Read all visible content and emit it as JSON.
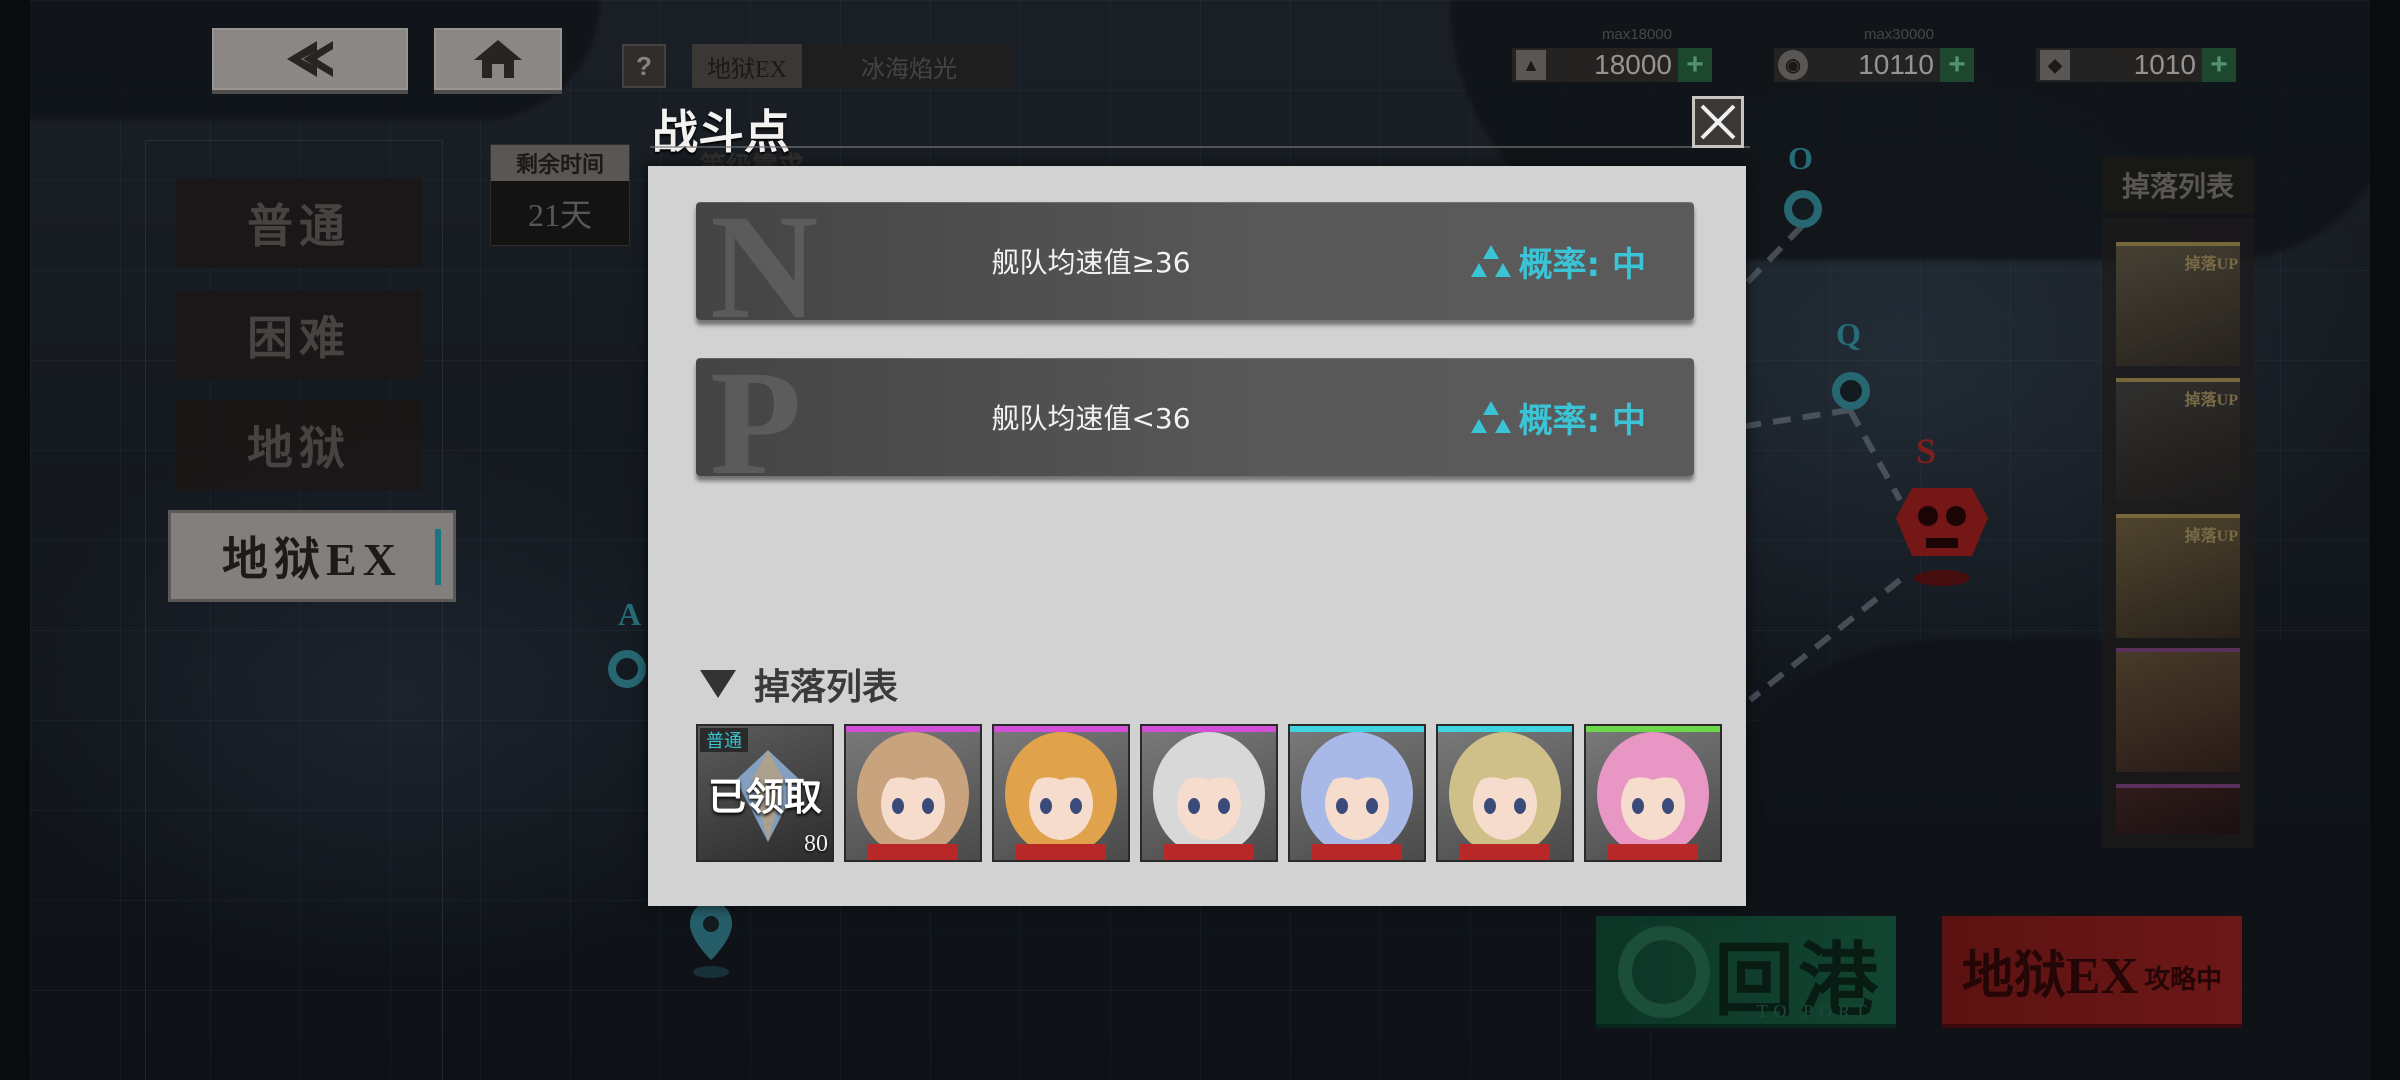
{
  "top": {
    "help_label": "?",
    "stage_tag": "地狱EX",
    "stage_name": "冰海焰光",
    "currencies": [
      {
        "icon": "oil-icon",
        "value": "18000",
        "max": "max18000"
      },
      {
        "icon": "coin-icon",
        "value": "10110",
        "max": "max30000"
      },
      {
        "icon": "gem-icon",
        "value": "1010",
        "max": ""
      }
    ]
  },
  "difficulty_tabs": [
    {
      "label": "普通",
      "active": false
    },
    {
      "label": "困难",
      "active": false
    },
    {
      "label": "地狱",
      "active": false
    },
    {
      "label": "地狱EX",
      "active": true
    }
  ],
  "info": {
    "remain_label": "剩余时间",
    "remain_value": "21天",
    "level_req": "等级需求"
  },
  "map": {
    "nodes": [
      "O",
      "Q",
      "S",
      "A"
    ]
  },
  "right_drop": {
    "title": "掉落列表",
    "up_label": "掉落UP"
  },
  "bottom": {
    "port_label": "回港",
    "port_sub": "TO PORT",
    "attack_label": "地狱EX",
    "attack_sub": "攻略中"
  },
  "modal": {
    "title": "战斗点",
    "routes": [
      {
        "letter": "N",
        "condition": "舰队均速值≥36",
        "probability": "概率: 中"
      },
      {
        "letter": "P",
        "condition": "舰队均速值<36",
        "probability": "概率: 中"
      }
    ],
    "drop_title": "掉落列表",
    "drops": [
      {
        "type": "gem",
        "badge": "普通",
        "status": "已领取",
        "count": "80"
      },
      {
        "type": "ship",
        "rarity": "purple",
        "hair": "#c9a27e"
      },
      {
        "type": "ship",
        "rarity": "purple",
        "hair": "#e0a24a"
      },
      {
        "type": "ship",
        "rarity": "purple",
        "hair": "#d8d8d8"
      },
      {
        "type": "ship",
        "rarity": "cyan",
        "hair": "#a8b9e8"
      },
      {
        "type": "ship",
        "rarity": "cyan",
        "hair": "#cfc08a"
      },
      {
        "type": "ship",
        "rarity": "green",
        "hair": "#e896c4"
      }
    ]
  },
  "colors": {
    "accent": "#3bc3d6",
    "purple": "#d44fd8",
    "cyan": "#3fd6e0",
    "green": "#6ad84a",
    "gold": "#b6a05a"
  }
}
